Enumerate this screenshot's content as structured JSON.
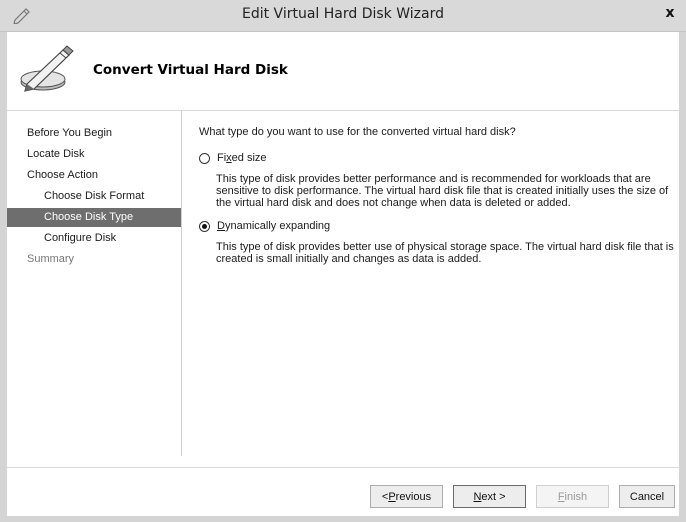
{
  "window": {
    "title": "Edit Virtual Hard Disk Wizard",
    "close_label": "x"
  },
  "header": {
    "title": "Convert Virtual Hard Disk"
  },
  "steps": [
    {
      "label": "Before You Begin",
      "state": "normal"
    },
    {
      "label": "Locate Disk",
      "state": "normal"
    },
    {
      "label": "Choose Action",
      "state": "normal"
    },
    {
      "label": "Choose Disk Format",
      "state": "sub"
    },
    {
      "label": "Choose Disk Type",
      "state": "active"
    },
    {
      "label": "Configure Disk",
      "state": "sub"
    },
    {
      "label": "Summary",
      "state": "disabled"
    }
  ],
  "content": {
    "question": "What type do you want to use for the converted virtual hard disk?",
    "options": [
      {
        "label_pre": "Fi",
        "label_key": "x",
        "label_post": "ed size",
        "checked": false,
        "description": "This type of disk provides better performance and is recommended for workloads that are sensitive to disk performance. The virtual hard disk file that is created initially uses the size of the virtual hard disk and does not change when data is deleted or added."
      },
      {
        "label_pre": "",
        "label_key": "D",
        "label_post": "ynamically expanding",
        "checked": true,
        "description": "This type of disk provides better use of physical storage space. The virtual hard disk file that is created is small initially and changes as data is added."
      }
    ]
  },
  "buttons": {
    "previous": {
      "pre": "< ",
      "key": "P",
      "post": "revious"
    },
    "next": {
      "pre": "",
      "key": "N",
      "post": "ext >"
    },
    "finish": {
      "pre": "",
      "key": "F",
      "post": "inish"
    },
    "cancel": {
      "label": "Cancel"
    }
  }
}
